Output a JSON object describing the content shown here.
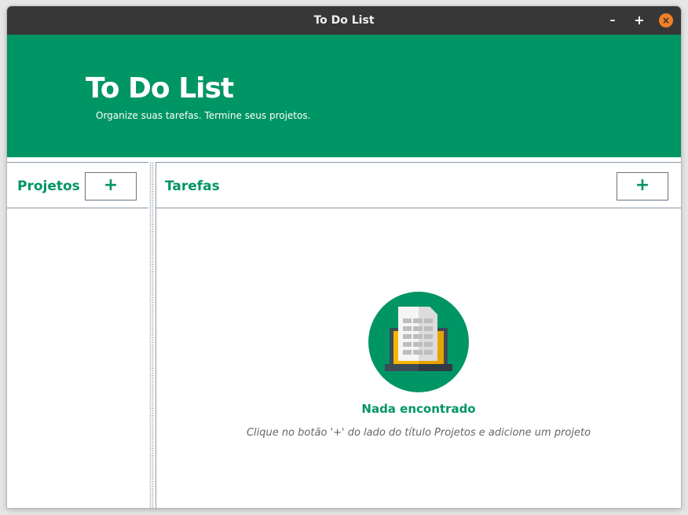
{
  "window": {
    "title": "To Do List",
    "controls": {
      "minimize": "–",
      "maximize": "+",
      "close": "×"
    }
  },
  "header": {
    "title": "To Do List",
    "subtitle": "Organize suas tarefas. Termine seus projetos."
  },
  "projects_panel": {
    "title": "Projetos",
    "add_label": "+"
  },
  "tasks_panel": {
    "title": "Tarefas",
    "add_label": "+",
    "empty_state": {
      "icon": "laptop-document-icon",
      "title": "Nada encontrado",
      "hint": "Clique no botão '+' do lado do título Projetos e adicione um projeto"
    }
  },
  "colors": {
    "accent": "#009564",
    "titlebar": "#373737",
    "close_button": "#ef8129"
  }
}
